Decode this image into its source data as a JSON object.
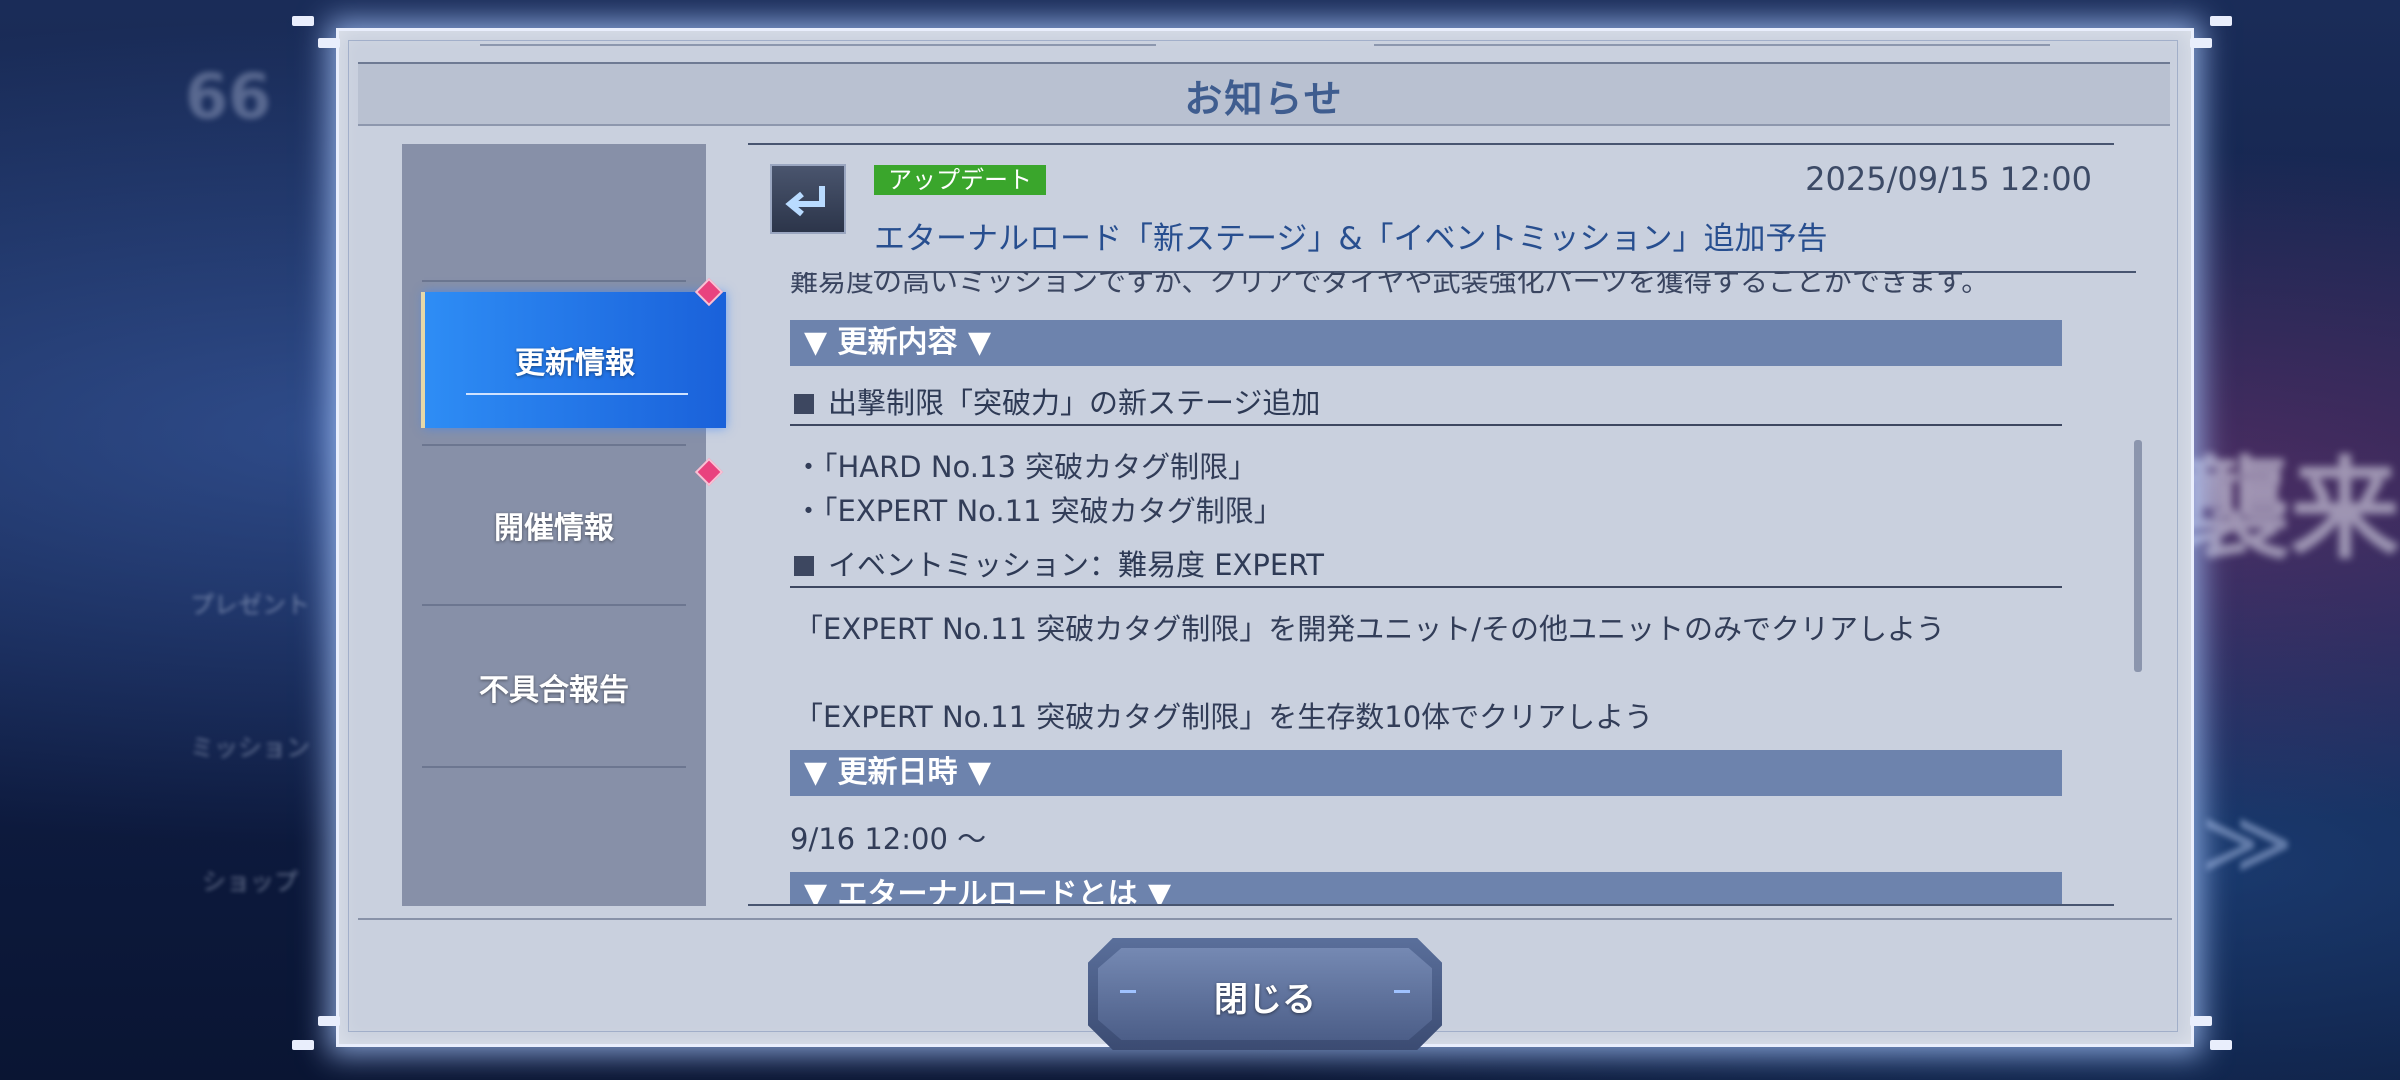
{
  "background": {
    "left_text": "66",
    "side_items": [
      "プレゼント",
      "ミッション",
      "ショップ"
    ],
    "right_text": "襲来"
  },
  "dialog": {
    "title": "お知らせ",
    "close_label": "閉じる"
  },
  "tabs": [
    {
      "label": "更新情報",
      "active": true
    },
    {
      "label": "開催情報",
      "active": false
    },
    {
      "label": "不具合報告",
      "active": false
    }
  ],
  "notice": {
    "badge": "アップデート",
    "date": "2025/09/15 12:00",
    "title": "エターナルロード「新ステージ」&「イベントミッション」追加予告",
    "cut_line": "難易度の高いミッションですが、クリアでダイヤや武装強化パーツを獲得することができます。",
    "section_update": "▼ 更新内容 ▼",
    "sub1": "出撃制限「突破力」の新ステージ追加",
    "sub1_items": [
      "・「HARD No.13 突破カタグ制限」",
      "・「EXPERT No.11 突破カタグ制限」"
    ],
    "sub2": "イベントミッション：難易度 EXPERT",
    "sub2_items": [
      "「EXPERT No.11 突破カタグ制限」を開発ユニット/その他ユニットのみでクリアしよう",
      "「EXPERT No.11 突破カタグ制限」を生存数10体でクリアしよう"
    ],
    "section_date": "▼ 更新日時 ▼",
    "update_time": "9/16 12:00 ～",
    "section_about": "▼ エターナルロードとは ▼"
  },
  "colors": {
    "active_tab": "#1a61da",
    "badge": "#3aa62c",
    "section_bar": "#6d83ad",
    "diamond": "#e9427e"
  }
}
